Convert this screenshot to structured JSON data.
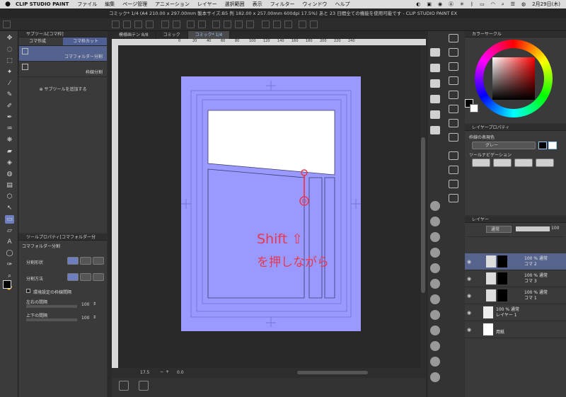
{
  "menubar": {
    "app": "CLIP STUDIO PAINT",
    "items": [
      "ファイル",
      "編集",
      "ページ管理",
      "アニメーション",
      "レイヤー",
      "選択範囲",
      "表示",
      "フィルター",
      "ウィンドウ",
      "ヘルプ"
    ],
    "date": "2月29日(木)"
  },
  "titlebar": {
    "text": "コミック* 1/4 (A4 210.00 x 297.00mm 製本サイズ:B5 判 182.00 x 257.00mm 600dpi 17.5%)  あと 23 日間全ての機能を使用可能です - CLIP STUDIO PAINT EX"
  },
  "doctabs": [
    "模様画テン 8/8",
    "コミック",
    "コミック*  1/4"
  ],
  "ruler": {
    "ticks": [
      "0",
      "20",
      "40",
      "60",
      "80",
      "100",
      "120",
      "140",
      "160",
      "180",
      "200",
      "220",
      "240"
    ]
  },
  "subtool": {
    "header": "サブツール[コマ枠]",
    "tabs": [
      "コマ作成",
      "コマ枠カット"
    ],
    "items": [
      {
        "name": "コマフォルダー分割"
      },
      {
        "name": "枠線分割"
      }
    ],
    "add_label": "サブツールを追加する"
  },
  "toolprop": {
    "header": "ツールプロパティ[コマフォルダー分",
    "subtitle": "コマフォルダー分割",
    "rows": {
      "shape": "分割形状",
      "method": "分割方法",
      "env": "環境設定の枠線間隔",
      "lr": "左右の間隔",
      "lr_val": "100",
      "tb": "上下の間隔",
      "tb_val": "100"
    }
  },
  "annotation": {
    "line1": "Shift ⇧",
    "line2": "を押しながら",
    "color": "#e8384f"
  },
  "status": {
    "zoom": "17.5",
    "angle": "0.0"
  },
  "colorpanel": {
    "header": "カラーサークル"
  },
  "layerprop": {
    "header": "レイヤープロパティ",
    "edge_label": "枠線の表現色",
    "edge_value": "グレー",
    "toolnav": "ツールナビゲーション"
  },
  "layers": {
    "header": "レイヤー",
    "blend": "通常",
    "opacity": "100",
    "rows": [
      {
        "mode": "100 % 通常",
        "name": "コマ 2",
        "selected": true
      },
      {
        "mode": "100 % 通常",
        "name": "コマ 3",
        "selected": false
      },
      {
        "mode": "100 % 通常",
        "name": "コマ 1",
        "selected": false
      },
      {
        "mode": "100 % 通常",
        "name": "レイヤー 1",
        "selected": false
      },
      {
        "mode": "",
        "name": "用紙",
        "selected": false
      }
    ]
  },
  "colors": {
    "accent": "#6e7fbf",
    "page": "#9999ff"
  }
}
